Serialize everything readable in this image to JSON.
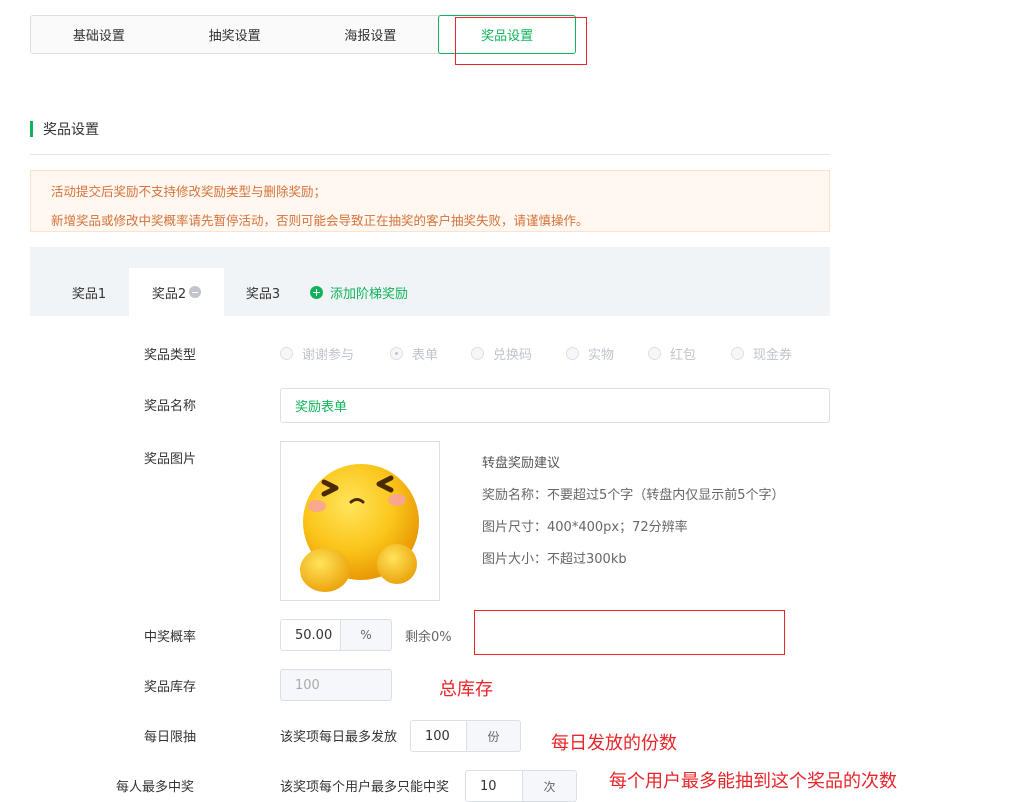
{
  "top_tabs": [
    "基础设置",
    "抽奖设置",
    "海报设置",
    "奖品设置"
  ],
  "section_title": "奖品设置",
  "notice": [
    "活动提交后奖励不支持修改奖励类型与删除奖励；",
    "新增奖品或修改中奖概率请先暂停活动，否则可能会导致正在抽奖的客户抽奖失败，请谨慎操作。"
  ],
  "prize_tabs": {
    "tab1": "奖品1",
    "tab2": "奖品2",
    "tab3": "奖品3",
    "add": "添加阶梯奖励"
  },
  "form": {
    "type_label": "奖品类型",
    "type_options": [
      "谢谢参与",
      "表单",
      "兑换码",
      "实物",
      "红包",
      "现金券"
    ],
    "type_selected": "表单",
    "name_label": "奖品名称",
    "name_value": "奖励表单",
    "image_label": "奖品图片",
    "tips": {
      "title": "转盘奖励建议",
      "line1": "奖励名称：不要超过5个字（转盘内仅显示前5个字）",
      "line2": "图片尺寸：400*400px；72分辨率",
      "line3": "图片大小：不超过300kb"
    },
    "prob_label": "中奖概率",
    "prob_value": "50.00",
    "prob_unit": "%",
    "prob_remain": "剩余0%",
    "stock_label": "奖品库存",
    "stock_value": "100",
    "daily_label": "每日限抽",
    "daily_prefix": "该奖项每日最多发放",
    "daily_value": "100",
    "daily_unit": "份",
    "per_user_label": "每人最多中奖",
    "per_user_prefix": "该奖项每个用户最多只能中奖",
    "per_user_value": "10",
    "per_user_unit": "次"
  },
  "annotations": {
    "stock": "总库存",
    "daily": "每日发放的份数",
    "per_user": "每个用户最多能抽到这个奖品的次数"
  },
  "colors": {
    "accent": "#10b35b",
    "annotation": "#e8252a",
    "notice_text": "#d4733a"
  }
}
